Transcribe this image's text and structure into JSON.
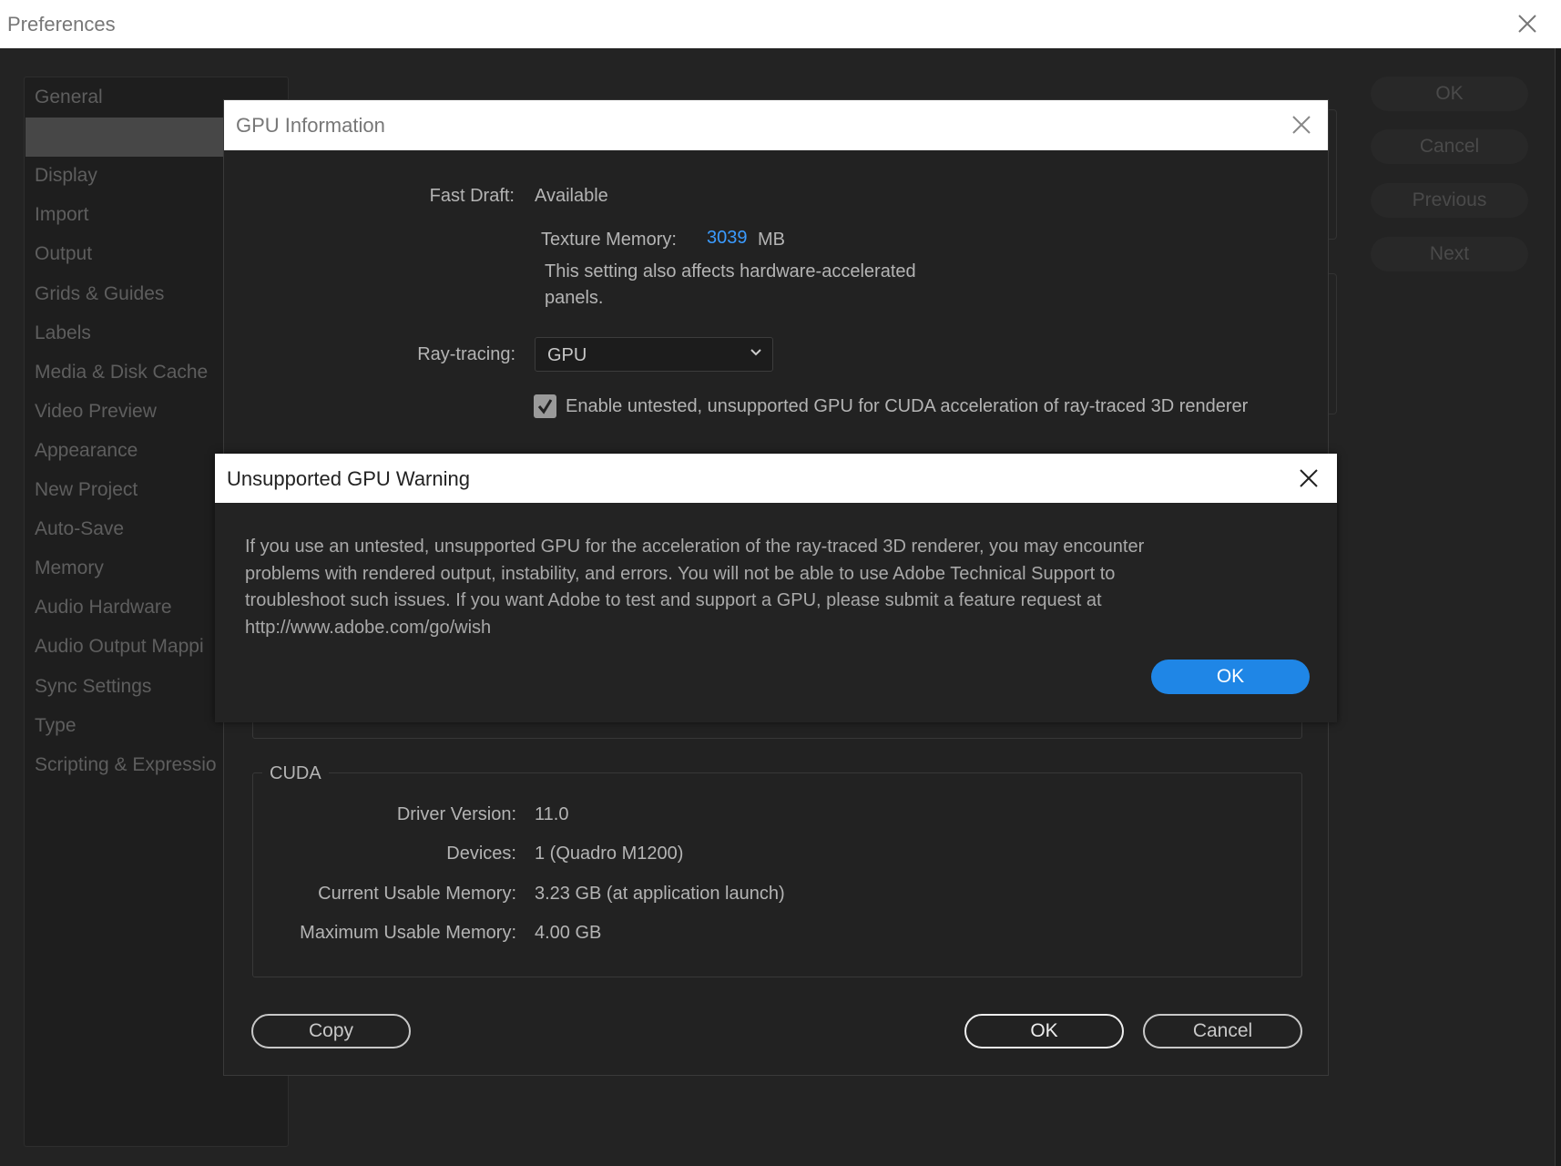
{
  "window": {
    "title": "Preferences",
    "close_icon": "close-icon"
  },
  "sidebar": {
    "items": [
      {
        "label": "General"
      },
      {
        "label": "",
        "selected": true
      },
      {
        "label": "Display"
      },
      {
        "label": "Import"
      },
      {
        "label": "Output"
      },
      {
        "label": "Grids & Guides"
      },
      {
        "label": "Labels"
      },
      {
        "label": "Media & Disk Cache"
      },
      {
        "label": "Video Preview"
      },
      {
        "label": "Appearance"
      },
      {
        "label": "New Project"
      },
      {
        "label": "Auto-Save"
      },
      {
        "label": "Memory"
      },
      {
        "label": "Audio Hardware"
      },
      {
        "label": "Audio Output Mappi"
      },
      {
        "label": "Sync Settings"
      },
      {
        "label": "Type"
      },
      {
        "label": "Scripting & Expressio"
      }
    ]
  },
  "side_buttons": {
    "ok": "OK",
    "cancel": "Cancel",
    "previous": "Previous",
    "next": "Next"
  },
  "gpu_dialog": {
    "title": "GPU Information",
    "fast_draft_label": "Fast Draft:",
    "fast_draft_value": "Available",
    "texture_memory_label": "Texture Memory:",
    "texture_memory_value": "3039",
    "texture_memory_unit": "MB",
    "texture_note_line1": "This setting also affects hardware-accelerated",
    "texture_note_line2": "panels.",
    "ray_tracing_label": "Ray-tracing:",
    "ray_tracing_value": "GPU",
    "enable_checkbox_label": "Enable untested, unsupported GPU for CUDA acceleration of ray-traced 3D renderer",
    "enable_checked": true,
    "cuda": {
      "title": "CUDA",
      "rows": [
        {
          "label": "Driver Version:",
          "value": "11.0"
        },
        {
          "label": "Devices:",
          "value": "1 (Quadro M1200)"
        },
        {
          "label": "Current Usable Memory:",
          "value": "3.23 GB (at application launch)"
        },
        {
          "label": "Maximum Usable Memory:",
          "value": "4.00 GB"
        }
      ]
    },
    "copy_button": "Copy",
    "ok_button": "OK",
    "cancel_button": "Cancel"
  },
  "warning_dialog": {
    "title": "Unsupported GPU Warning",
    "lines": [
      "If you use an untested, unsupported GPU for the acceleration of the ray-traced 3D renderer, you may encounter",
      "problems with rendered output, instability, and errors. You will not be able to use Adobe Technical Support to",
      "troubleshoot such issues. If you want Adobe to test and support a GPU, please submit a feature request at",
      "http://www.adobe.com/go/wish"
    ],
    "ok_button": "OK"
  },
  "colors": {
    "accent": "#1f86e6",
    "texture_value": "#3b9bff",
    "background": "#232323"
  }
}
